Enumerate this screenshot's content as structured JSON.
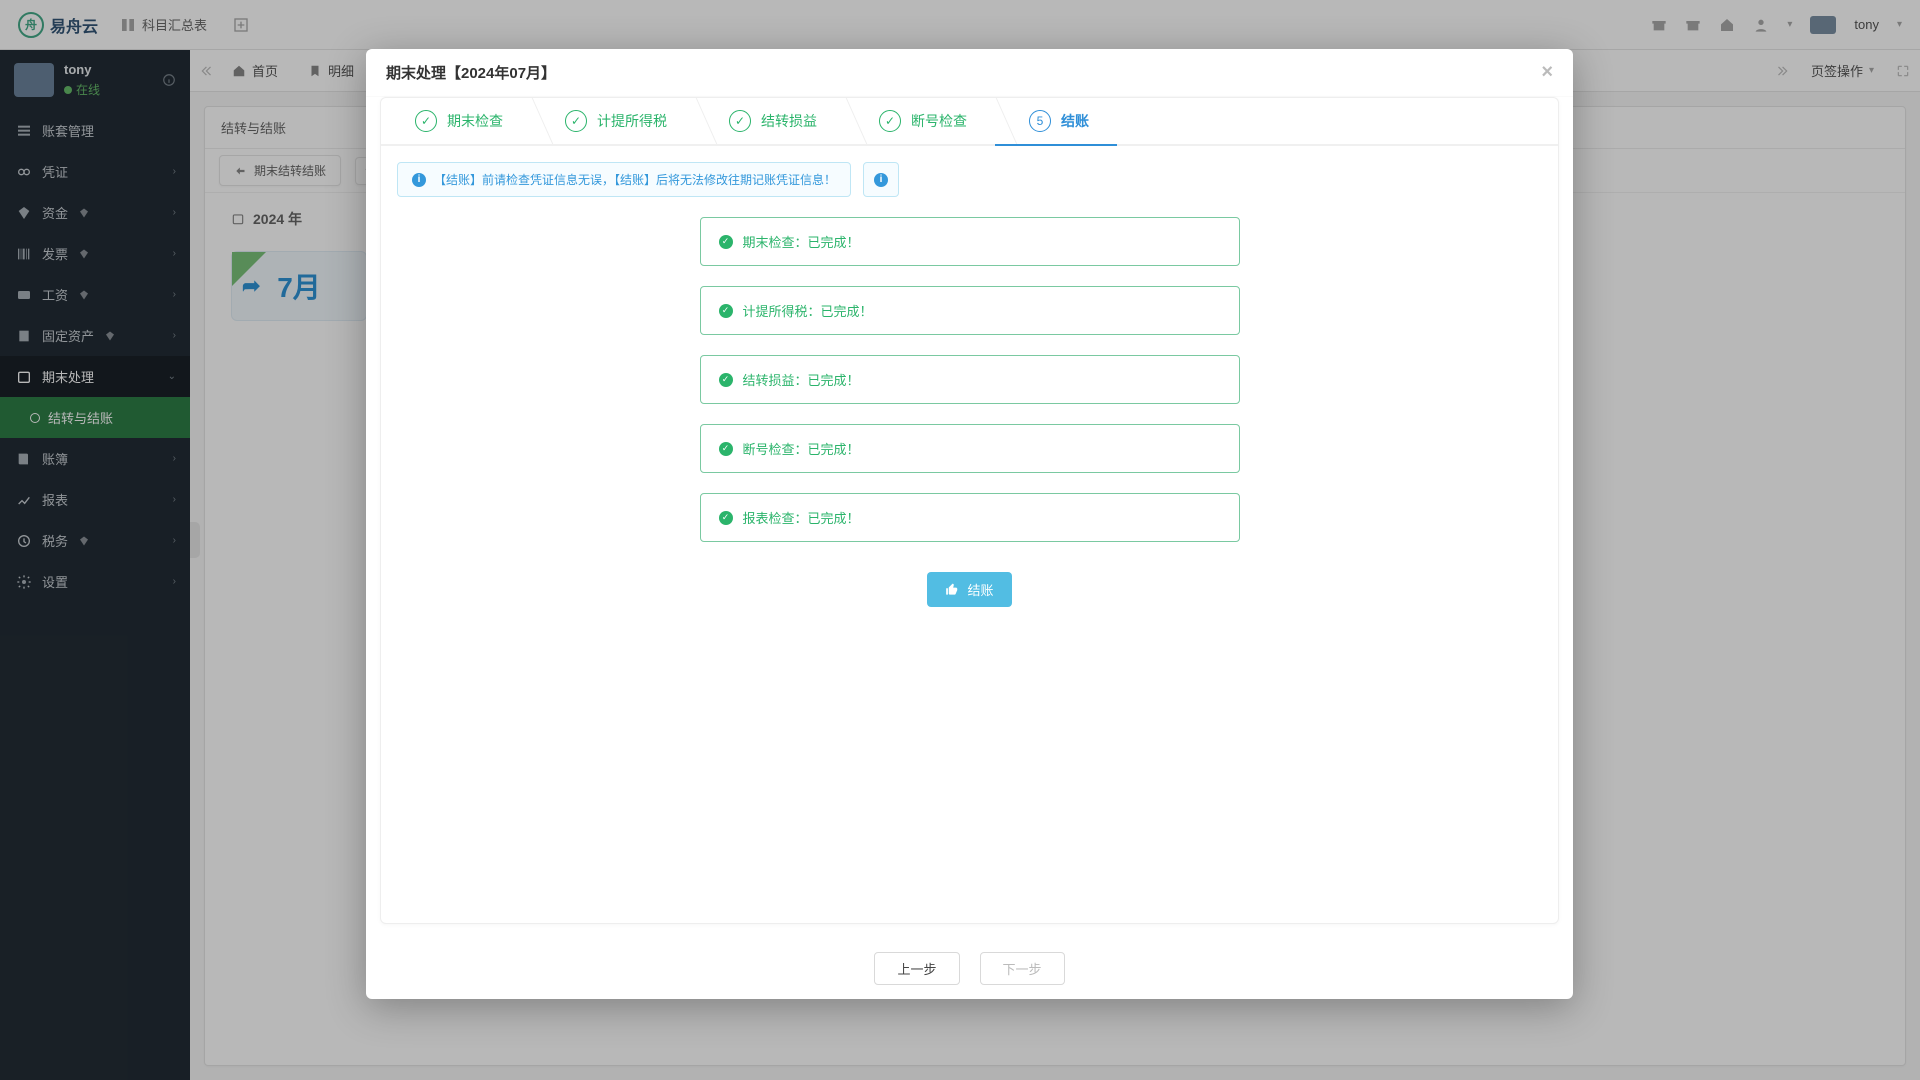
{
  "brand": "易舟云",
  "topnav": {
    "subjects": "科目汇总表",
    "user": "tony"
  },
  "sidebar": {
    "user": {
      "name": "tony",
      "status": "在线"
    },
    "items": [
      {
        "label": "账套管理",
        "expandable": false
      },
      {
        "label": "凭证",
        "expandable": true
      },
      {
        "label": "资金",
        "expandable": true,
        "badge": true
      },
      {
        "label": "发票",
        "expandable": true,
        "badge": true
      },
      {
        "label": "工资",
        "expandable": true,
        "badge": true
      },
      {
        "label": "固定资产",
        "expandable": true,
        "badge": true
      },
      {
        "label": "期末处理",
        "expandable": true,
        "open": true
      },
      {
        "label": "账簿",
        "expandable": true
      },
      {
        "label": "报表",
        "expandable": true
      },
      {
        "label": "税务",
        "expandable": true,
        "badge": true
      },
      {
        "label": "设置",
        "expandable": true
      }
    ],
    "sub_item": "结转与结账"
  },
  "tabs": {
    "home": "首页",
    "detail": "明细",
    "actions": "页签操作"
  },
  "panel": {
    "title": "结转与结账",
    "sub1": "期末结转结账",
    "year": "2024 年",
    "month": "7月"
  },
  "modal": {
    "title": "期末处理【2024年07月】",
    "steps": [
      {
        "label": "期末检查",
        "done": true
      },
      {
        "label": "计提所得税",
        "done": true
      },
      {
        "label": "结转损益",
        "done": true
      },
      {
        "label": "断号检查",
        "done": true
      },
      {
        "label": "结账",
        "done": false,
        "num": "5"
      }
    ],
    "alert_text": "【结账】前请检查凭证信息无误，【结账】后将无法修改往期记账凭证信息！",
    "statuses": [
      "期末检查：已完成！",
      "计提所得税：已完成！",
      "结转损益：已完成！",
      "断号检查：已完成！",
      "报表检查：已完成！"
    ],
    "action_label": "结账",
    "btn_prev": "上一步",
    "btn_next": "下一步"
  }
}
